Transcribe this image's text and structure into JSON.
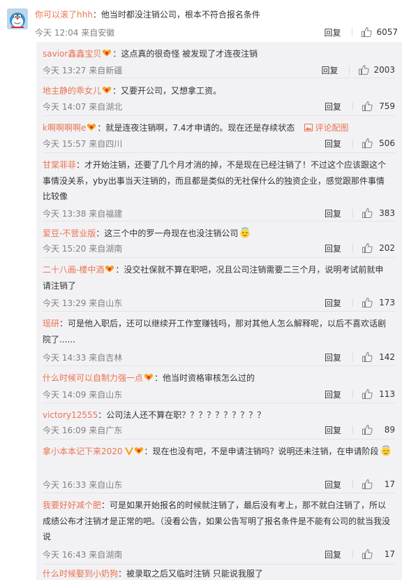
{
  "main": {
    "user": "你可以滚了hhh",
    "text": "：他当时都没注销公司，根本不符合报名条件",
    "time": "今天 12:04 来自安徽",
    "reply_label": "回复",
    "likes": "6057"
  },
  "replies": [
    {
      "user": "savior鑫鑫宝贝",
      "text": "：这点真的很奇怪 被发现了才连夜注销",
      "time": "今天 13:27 来自新疆",
      "reply_label": "回复",
      "likes": "2003"
    },
    {
      "user": "地主静的乖女儿",
      "text": "：又要开公司，又想拿工资。",
      "time": "今天 14:07 来自湖北",
      "reply_label": "回复",
      "likes": "759"
    },
    {
      "user": "k啊啊啊啊e",
      "text": "：就是连夜注销啊，7.4才申请的。现在还是存续状态",
      "pic_link": "评论配图",
      "time": "今天 15:57 来自四川",
      "reply_label": "回复",
      "likes": "506"
    },
    {
      "user": "甘棠菲菲",
      "text": "：才开始注销，还要了几个月才消的掉，不是现在已经注销了！不过这个应该跟这个事情没关系，yby出事当天注销的，而且都是类似的无社保什么的独资企业，感觉跟那件事情比较像",
      "time": "今天 13:38 来自福建",
      "reply_label": "回复",
      "likes": "383"
    },
    {
      "user": "爱豆-不营业版",
      "text": "：这三个中的罗一舟现在也没注销公司",
      "time": "今天 15:20 来自湖南",
      "reply_label": "回复",
      "likes": "202"
    },
    {
      "user": "二十八画-楼中酒",
      "text": "：没交社保就不算在职吧，况且公司注销需要二三个月，说明考试前就申请注销了",
      "time": "今天 13:29 来自山东",
      "reply_label": "回复",
      "likes": "173"
    },
    {
      "user": "瑶研",
      "text": "：可是他入职后，还可以继续开工作室赚钱吗，那对其他人怎么解释呢，以后不喜欢话剧院了......",
      "time": "今天 14:33 来自吉林",
      "reply_label": "回复",
      "likes": "142"
    },
    {
      "user": "什么时候可以自制力强一点",
      "text": "：他当时资格审核怎么过的",
      "time": "今天 14:09 来自山东",
      "reply_label": "回复",
      "likes": "113"
    },
    {
      "user": "victory12555",
      "text": "：公司法人还不算在职？？？？？？？？？？",
      "time": "今天 16:09 来自广东",
      "reply_label": "回复",
      "likes": "89"
    },
    {
      "user": "拿小本本记下来2020",
      "text": "：现在也没有吧，不是申请注销吗？说明还未注销，在申请阶段",
      "time": "今天 16:33 来自山东",
      "reply_label": "回复",
      "likes": "17"
    },
    {
      "user": "我要好好减个肥",
      "text": "：可是如果开始报名的时候就注销了，最后没有考上，那不就白注销了，所以成绩公布才注销才是正常的吧。（没看公告，如果公告写明了报名条件是不能有公司的就当我没说",
      "time": "今天 16:43 来自湖南",
      "reply_label": "回复",
      "likes": "17"
    },
    {
      "user": "什么时候娶到小奶狗",
      "text": "：被录取之后又临时注销 只能说我服了",
      "time": "",
      "reply_label": "",
      "likes": ""
    }
  ],
  "colors": {
    "username": "#eb7350",
    "meta": "#808080",
    "text": "#333333",
    "reply_bg": "#f2f2f5"
  }
}
